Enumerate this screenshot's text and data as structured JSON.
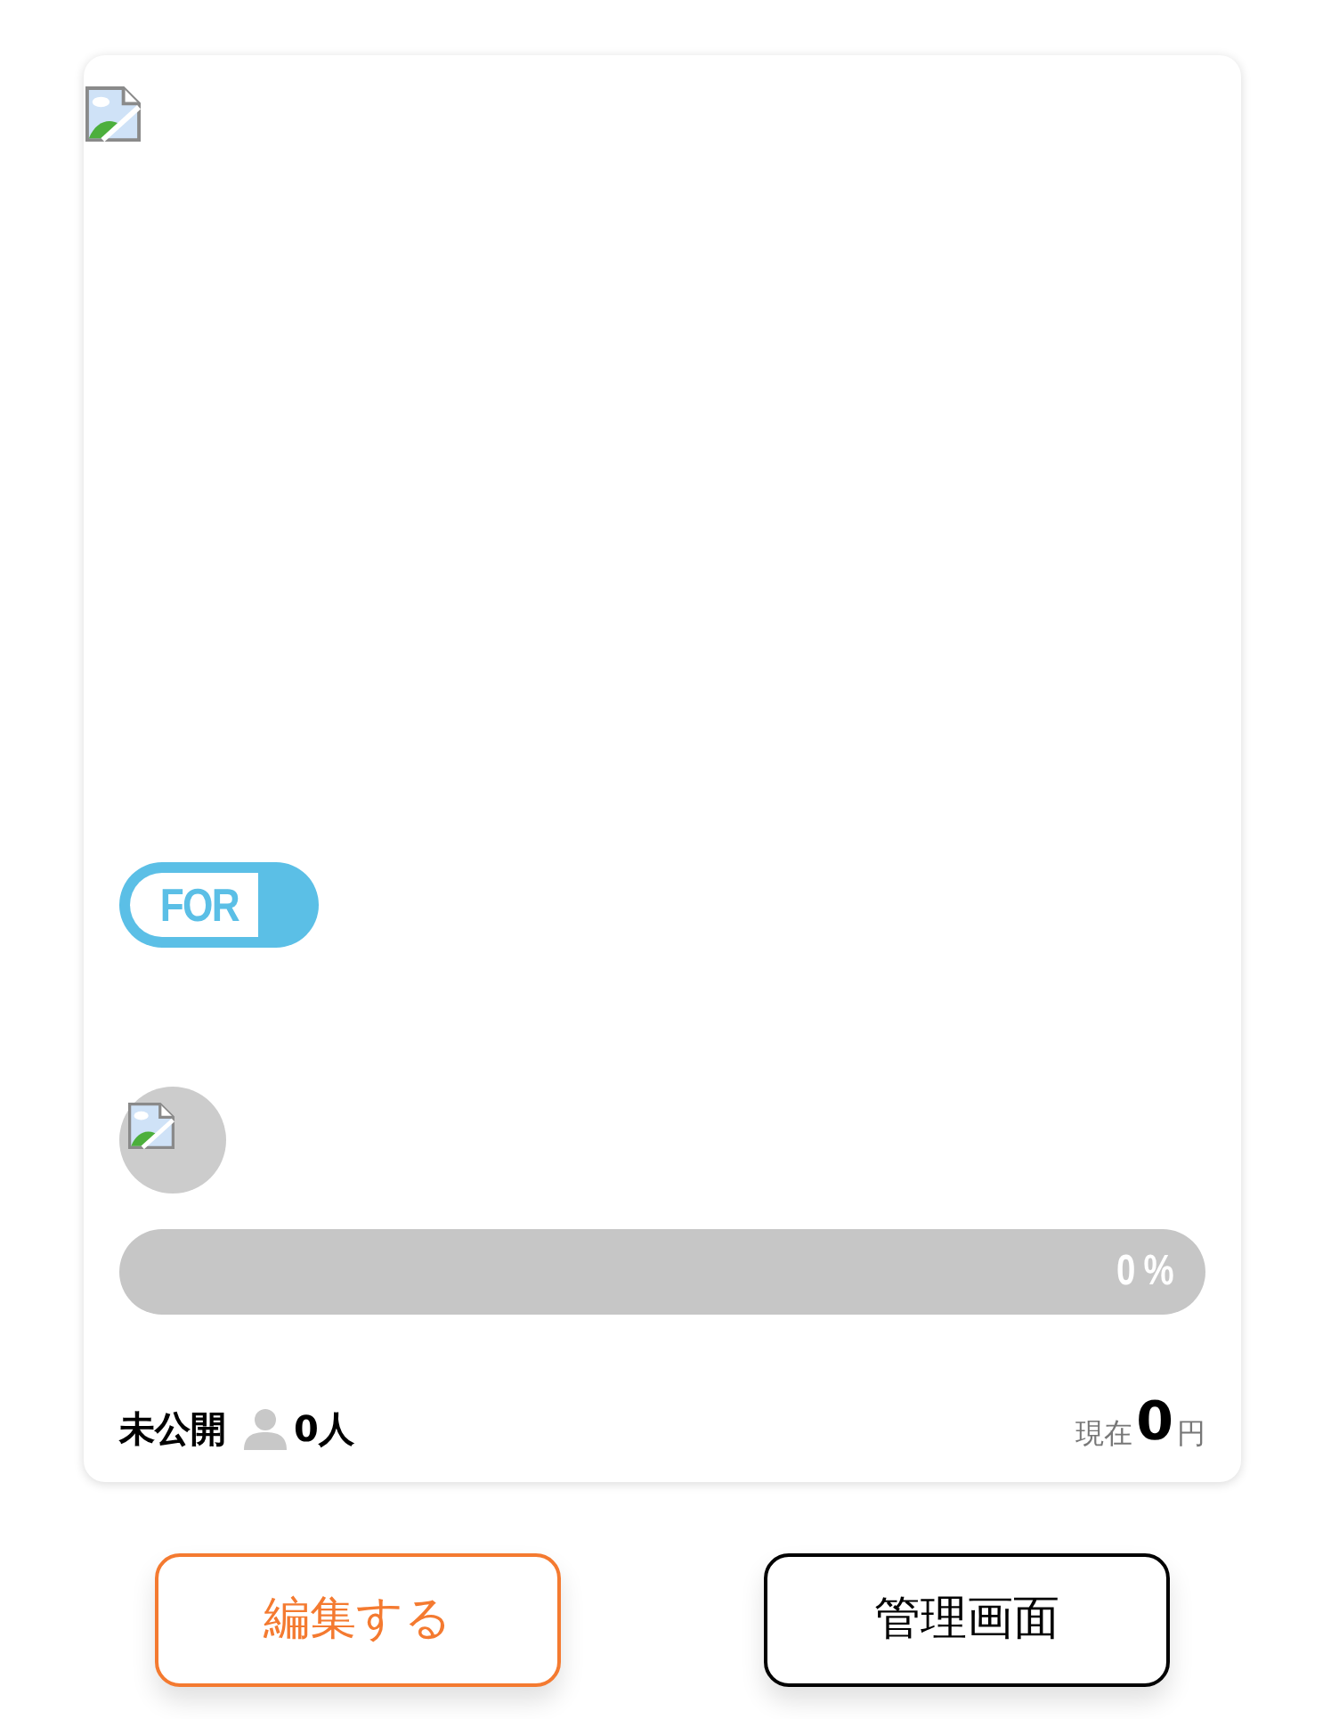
{
  "card": {
    "badge": {
      "label": "FOR"
    },
    "progress": {
      "level": 0,
      "reading": "0 %"
    },
    "footer": {
      "status": "未公開",
      "supporters": "0人",
      "current_label": "現在",
      "amount": "0",
      "unit": "円"
    }
  },
  "buttons": [
    {
      "label": "編集する",
      "kind": "accent"
    },
    {
      "label": "管理画面",
      "kind": "plain"
    }
  ]
}
